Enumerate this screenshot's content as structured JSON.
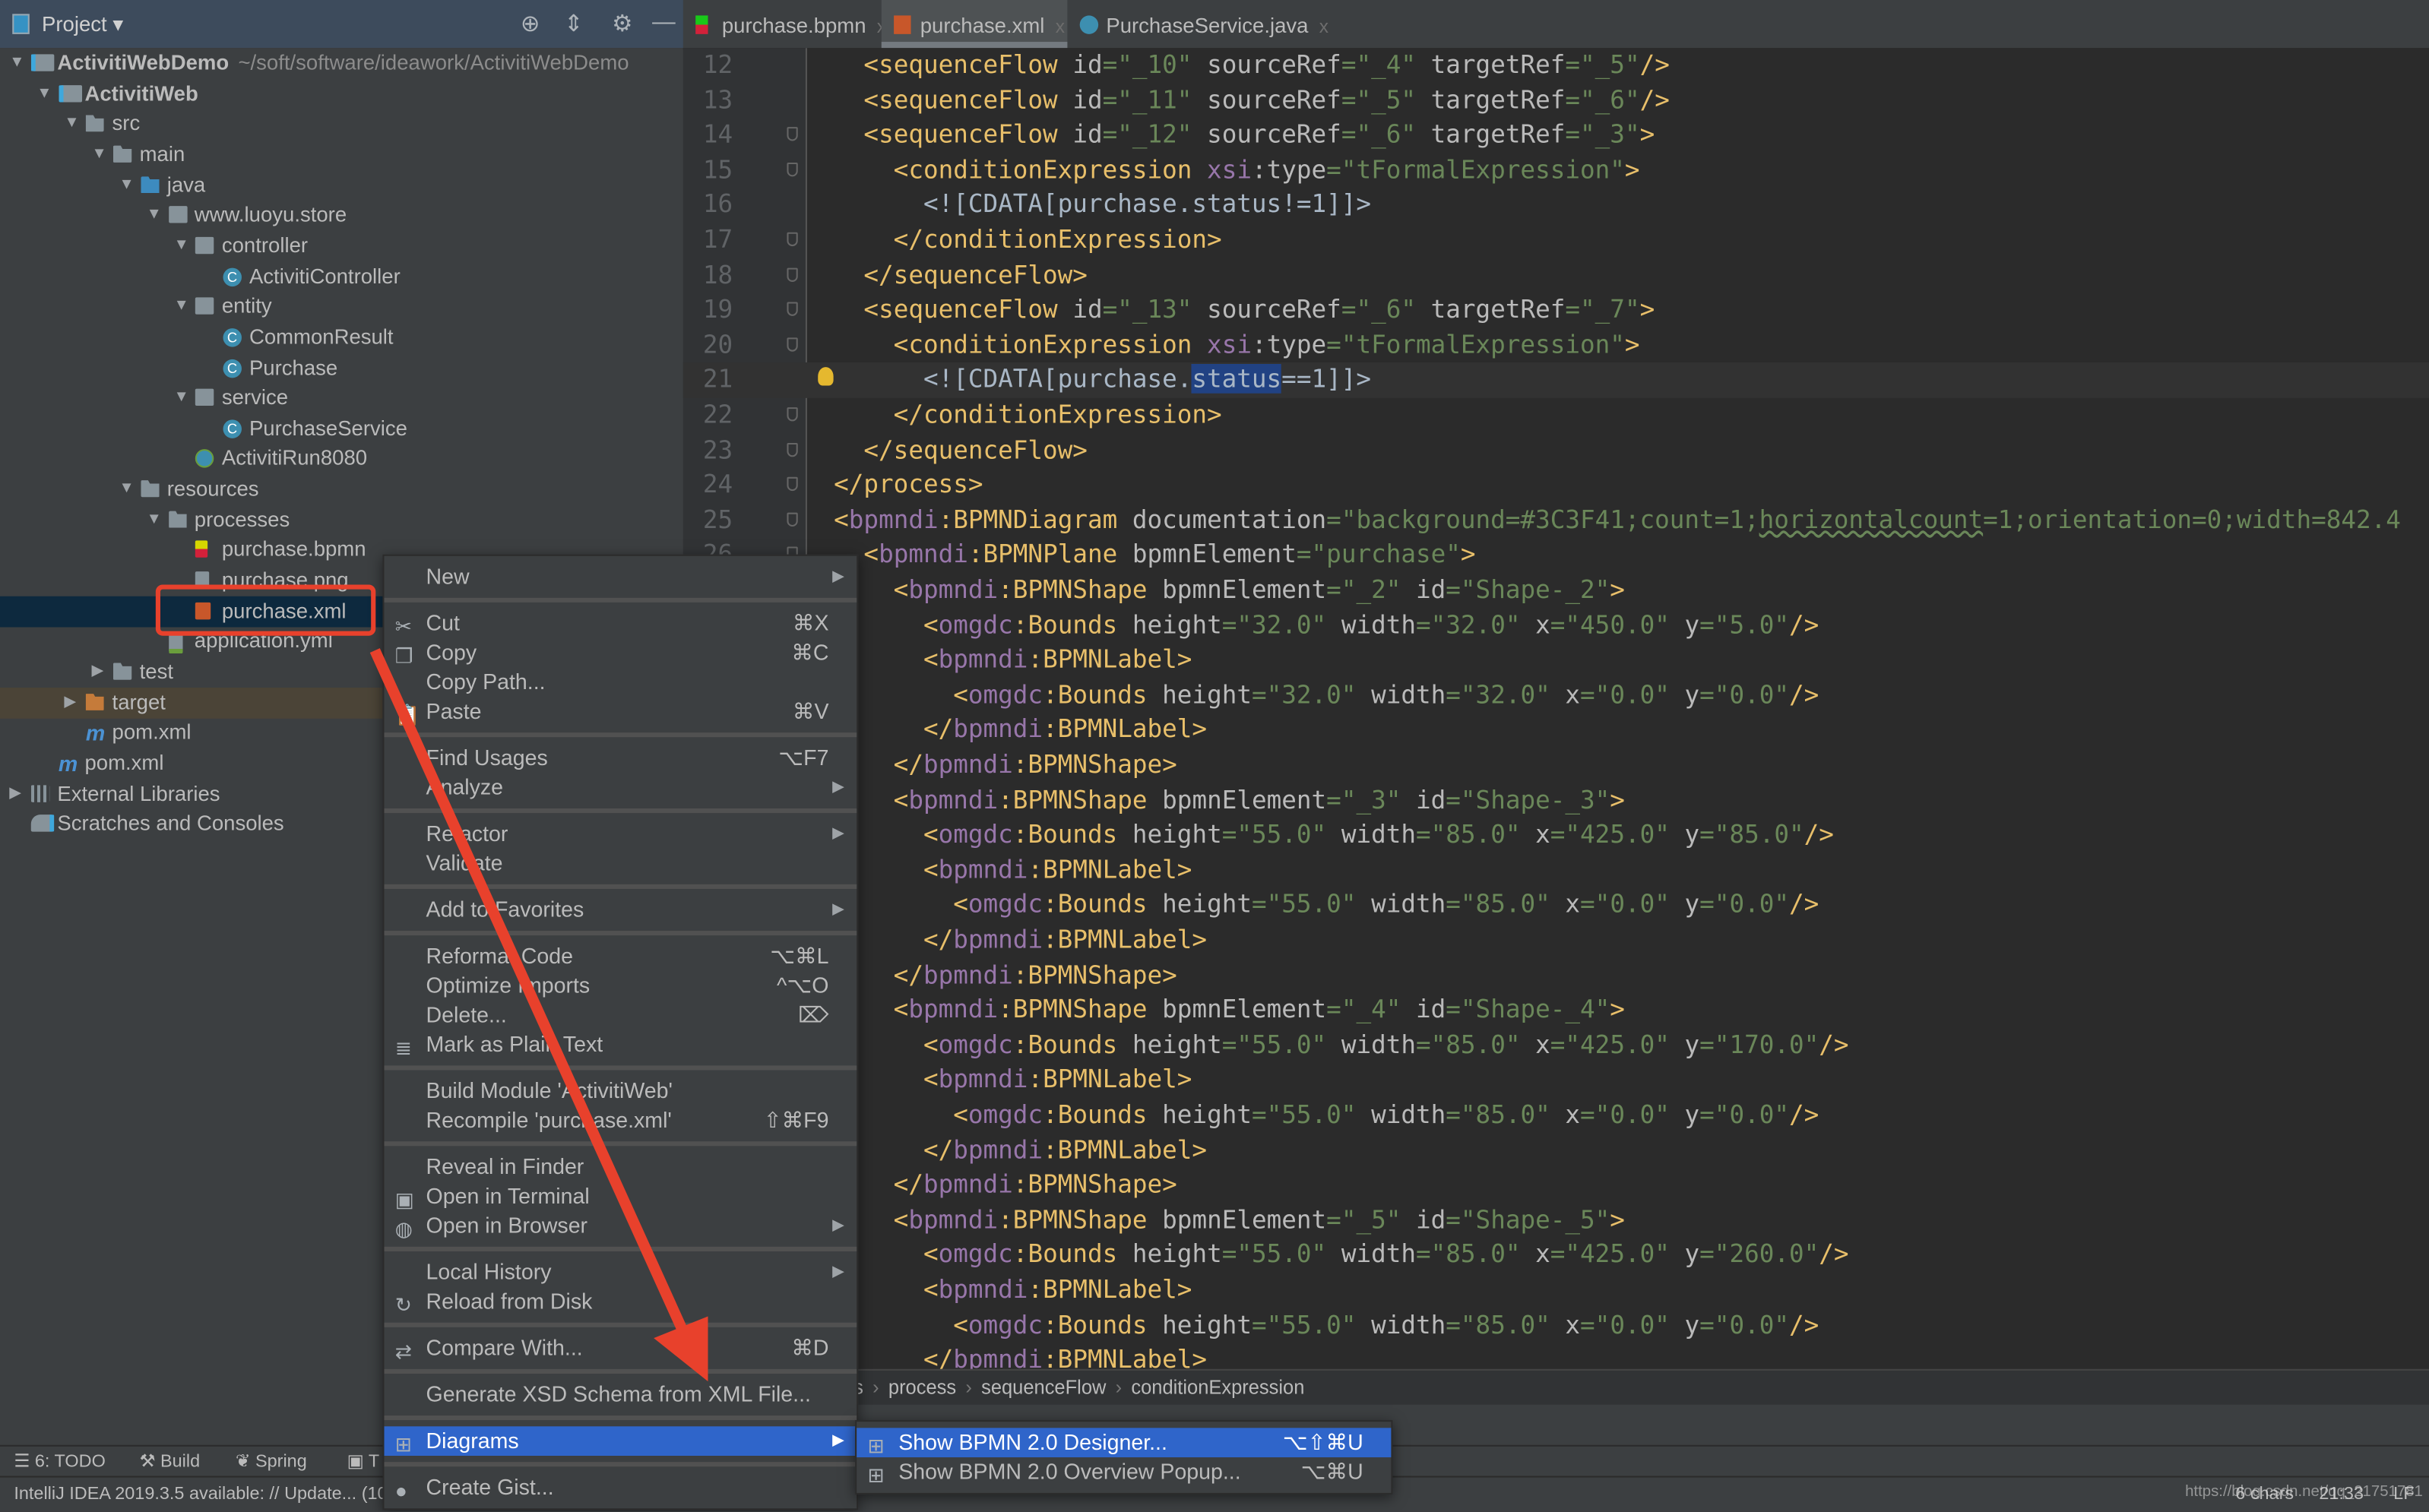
{
  "project_panel": {
    "title": "Project ▾",
    "icons": [
      "locate-icon",
      "collapse-icon",
      "gear-icon",
      "hide-icon"
    ]
  },
  "tree": [
    {
      "label": "ActivitiWebDemo",
      "path": "~/soft/software/ideawork/ActivitiWebDemo",
      "level": 0,
      "arrow": "down",
      "icon": "module",
      "bold": true
    },
    {
      "label": "ActivitiWeb",
      "level": 1,
      "arrow": "down",
      "icon": "module",
      "bold": true
    },
    {
      "label": "src",
      "level": 2,
      "arrow": "down",
      "icon": "srcfolder"
    },
    {
      "label": "main",
      "level": 3,
      "arrow": "down",
      "icon": "folder"
    },
    {
      "label": "java",
      "level": 4,
      "arrow": "down",
      "icon": "java"
    },
    {
      "label": "www.luoyu.store",
      "level": 5,
      "arrow": "down",
      "icon": "package"
    },
    {
      "label": "controller",
      "level": 6,
      "arrow": "down",
      "icon": "package"
    },
    {
      "label": "ActivitiController",
      "level": 7,
      "icon": "cls"
    },
    {
      "label": "entity",
      "level": 6,
      "arrow": "down",
      "icon": "package"
    },
    {
      "label": "CommonResult",
      "level": 7,
      "icon": "cls"
    },
    {
      "label": "Purchase",
      "level": 7,
      "icon": "cls"
    },
    {
      "label": "service",
      "level": 6,
      "arrow": "down",
      "icon": "package"
    },
    {
      "label": "PurchaseService",
      "level": 7,
      "icon": "cls"
    },
    {
      "label": "ActivitiRun8080",
      "level": 6,
      "icon": "spring"
    },
    {
      "label": "resources",
      "level": 4,
      "arrow": "down",
      "icon": "res"
    },
    {
      "label": "processes",
      "level": 5,
      "arrow": "down",
      "icon": "folder"
    },
    {
      "label": "purchase.bpmn",
      "level": 6,
      "icon": "bpmn"
    },
    {
      "label": "purchase.png",
      "level": 6,
      "icon": "png"
    },
    {
      "label": "purchase.xml",
      "level": 6,
      "icon": "xml",
      "selected": true
    },
    {
      "label": "application.yml",
      "level": 5,
      "icon": "yml"
    },
    {
      "label": "test",
      "level": 3,
      "arrow": "right",
      "icon": "folder"
    },
    {
      "label": "target",
      "level": 2,
      "arrow": "right",
      "icon": "target",
      "highlighted": true
    },
    {
      "label": "pom.xml",
      "level": 2,
      "icon": "maven"
    },
    {
      "label": "pom.xml",
      "level": 1,
      "icon": "maven"
    },
    {
      "label": "External Libraries",
      "level": 0,
      "arrow": "right",
      "icon": "lib"
    },
    {
      "label": "Scratches and Consoles",
      "level": 0,
      "icon": "scratch"
    }
  ],
  "tabs": [
    {
      "label": "purchase.bpmn",
      "icon": "bpmn-icon",
      "close": "x"
    },
    {
      "label": "purchase.xml",
      "icon": "xml-icon",
      "close": "x",
      "active": true
    },
    {
      "label": "PurchaseService.java",
      "icon": "class-icon",
      "close": "x"
    }
  ],
  "editor": {
    "caret_line": 21,
    "selection": "status",
    "typo": "horizontalcount",
    "lines": [
      {
        "n": "12",
        "text": "    <sequenceFlow id=\"_10\" sourceRef=\"_4\" targetRef=\"_5\"/>"
      },
      {
        "n": "13",
        "text": "    <sequenceFlow id=\"_11\" sourceRef=\"_5\" targetRef=\"_6\"/>"
      },
      {
        "n": "14",
        "text": "    <sequenceFlow id=\"_12\" sourceRef=\"_6\" targetRef=\"_3\">",
        "fold": true
      },
      {
        "n": "15",
        "text": "      <conditionExpression xsi:type=\"tFormalExpression\">",
        "fold": true
      },
      {
        "n": "16",
        "text": "        <![CDATA[purchase.status!=1]]>"
      },
      {
        "n": "17",
        "text": "      </conditionExpression>",
        "fold": true
      },
      {
        "n": "18",
        "text": "    </sequenceFlow>",
        "fold": true
      },
      {
        "n": "19",
        "text": "    <sequenceFlow id=\"_13\" sourceRef=\"_6\" targetRef=\"_7\">",
        "fold": true
      },
      {
        "n": "20",
        "text": "      <conditionExpression xsi:type=\"tFormalExpression\">",
        "fold": true
      },
      {
        "n": "21",
        "text": "        <![CDATA[purchase.status==1]]>",
        "bulb": true
      },
      {
        "n": "22",
        "text": "      </conditionExpression>",
        "fold": true
      },
      {
        "n": "23",
        "text": "    </sequenceFlow>",
        "fold": true
      },
      {
        "n": "24",
        "text": "  </process>",
        "fold": true
      },
      {
        "n": "25",
        "text": "  <bpmndi:BPMNDiagram documentation=\"background=#3C3F41;count=1;horizontalcount=1;orientation=0;width=842.4",
        "fold": true
      },
      {
        "n": "26",
        "text": "    <bpmndi:BPMNPlane bpmnElement=\"purchase\">",
        "fold": true
      },
      {
        "n": "27",
        "text": "      <bpmndi:BPMNShape bpmnElement=\"_2\" id=\"Shape-_2\">"
      },
      {
        "n": "28",
        "text": "        <omgdc:Bounds height=\"32.0\" width=\"32.0\" x=\"450.0\" y=\"5.0\"/>"
      },
      {
        "n": "29",
        "text": "        <bpmndi:BPMNLabel>"
      },
      {
        "n": "30",
        "text": "          <omgdc:Bounds height=\"32.0\" width=\"32.0\" x=\"0.0\" y=\"0.0\"/>"
      },
      {
        "n": "31",
        "text": "        </bpmndi:BPMNLabel>"
      },
      {
        "n": "32",
        "text": "      </bpmndi:BPMNShape>"
      },
      {
        "n": "33",
        "text": "      <bpmndi:BPMNShape bpmnElement=\"_3\" id=\"Shape-_3\">"
      },
      {
        "n": "34",
        "text": "        <omgdc:Bounds height=\"55.0\" width=\"85.0\" x=\"425.0\" y=\"85.0\"/>"
      },
      {
        "n": "35",
        "text": "        <bpmndi:BPMNLabel>"
      },
      {
        "n": "36",
        "text": "          <omgdc:Bounds height=\"55.0\" width=\"85.0\" x=\"0.0\" y=\"0.0\"/>"
      },
      {
        "n": "37",
        "text": "        </bpmndi:BPMNLabel>"
      },
      {
        "n": "38",
        "text": "      </bpmndi:BPMNShape>"
      },
      {
        "n": "39",
        "text": "      <bpmndi:BPMNShape bpmnElement=\"_4\" id=\"Shape-_4\">"
      },
      {
        "n": "40",
        "text": "        <omgdc:Bounds height=\"55.0\" width=\"85.0\" x=\"425.0\" y=\"170.0\"/>"
      },
      {
        "n": "41",
        "text": "        <bpmndi:BPMNLabel>"
      },
      {
        "n": "42",
        "text": "          <omgdc:Bounds height=\"55.0\" width=\"85.0\" x=\"0.0\" y=\"0.0\"/>"
      },
      {
        "n": "43",
        "text": "        </bpmndi:BPMNLabel>"
      },
      {
        "n": "44",
        "text": "      </bpmndi:BPMNShape>"
      },
      {
        "n": "45",
        "text": "      <bpmndi:BPMNShape bpmnElement=\"_5\" id=\"Shape-_5\">"
      },
      {
        "n": "46",
        "text": "        <omgdc:Bounds height=\"55.0\" width=\"85.0\" x=\"425.0\" y=\"260.0\"/>"
      },
      {
        "n": "47",
        "text": "        <bpmndi:BPMNLabel>"
      },
      {
        "n": "48",
        "text": "          <omgdc:Bounds height=\"55.0\" width=\"85.0\" x=\"0.0\" y=\"0.0\"/>"
      },
      {
        "n": "49",
        "text": "        </bpmndi:BPMNLabel>"
      }
    ]
  },
  "breadcrumb": [
    "definitions",
    "process",
    "sequenceFlow",
    "conditionExpression"
  ],
  "context_menu": [
    [
      {
        "label": "New",
        "submenu": true
      }
    ],
    [
      {
        "label": "Cut",
        "shortcut": "⌘X",
        "icon": "✂"
      },
      {
        "label": "Copy",
        "shortcut": "⌘C",
        "icon": "❐"
      },
      {
        "label": "Copy Path..."
      },
      {
        "label": "Paste",
        "shortcut": "⌘V",
        "icon": "📋"
      }
    ],
    [
      {
        "label": "Find Usages",
        "shortcut": "⌥F7"
      },
      {
        "label": "Analyze",
        "submenu": true
      }
    ],
    [
      {
        "label": "Refactor",
        "submenu": true
      },
      {
        "label": "Validate"
      }
    ],
    [
      {
        "label": "Add to Favorites",
        "submenu": true
      }
    ],
    [
      {
        "label": "Reformat Code",
        "shortcut": "⌥⌘L"
      },
      {
        "label": "Optimize Imports",
        "shortcut": "^⌥O"
      },
      {
        "label": "Delete...",
        "shortcut": "⌦"
      },
      {
        "label": "Mark as Plain Text",
        "icon": "≣"
      }
    ],
    [
      {
        "label": "Build Module 'ActivitiWeb'"
      },
      {
        "label": "Recompile 'purchase.xml'",
        "shortcut": "⇧⌘F9"
      }
    ],
    [
      {
        "label": "Reveal in Finder"
      },
      {
        "label": "Open in Terminal",
        "icon": "▣"
      },
      {
        "label": "Open in Browser",
        "submenu": true,
        "icon": "◍"
      }
    ],
    [
      {
        "label": "Local History",
        "submenu": true
      },
      {
        "label": "Reload from Disk",
        "icon": "↻"
      }
    ],
    [
      {
        "label": "Compare With...",
        "shortcut": "⌘D",
        "icon": "⇄"
      }
    ],
    [
      {
        "label": "Generate XSD Schema from XML File..."
      }
    ],
    [
      {
        "label": "Diagrams",
        "submenu": true,
        "active": true,
        "icon": "⊞"
      }
    ],
    [
      {
        "label": "Create Gist...",
        "icon": "●"
      }
    ]
  ],
  "submenu": [
    {
      "label": "Show BPMN 2.0 Designer...",
      "shortcut": "⌥⇧⌘U",
      "active": true,
      "icon": "⊞"
    },
    {
      "label": "Show BPMN 2.0 Overview Popup...",
      "shortcut": "⌥⌘U",
      "icon": "⊞"
    }
  ],
  "tool_windows": [
    {
      "label": "6: TODO",
      "icon": "☰"
    },
    {
      "label": "Build",
      "icon": "⚒"
    },
    {
      "label": "Spring",
      "icon": "❦"
    },
    {
      "label": "T",
      "icon": "▣"
    }
  ],
  "status": {
    "message": "IntelliJ IDEA 2019.3.5 available: // Update... (10",
    "chars": "6 chars",
    "position": "21:33",
    "line_sep": "LF"
  },
  "watermark": "https://blog.csdn.net/qq_21751781",
  "annotation_color": "#e8412c"
}
